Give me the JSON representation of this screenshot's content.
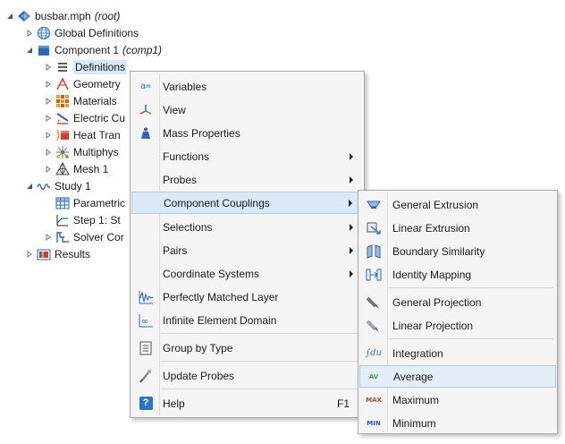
{
  "tree": {
    "root": {
      "label": "busbar.mph",
      "suffix": "(root)"
    },
    "global_definitions": "Global Definitions",
    "component": {
      "label": "Component 1",
      "suffix": "(comp1)"
    },
    "definitions": "Definitions",
    "geometry": "Geometry",
    "materials": "Materials",
    "electric_currents": "Electric Cu",
    "heat_transfer": "Heat Tran",
    "multiphysics": "Multiphys",
    "mesh": "Mesh 1",
    "study": "Study 1",
    "parametric": "Parametric",
    "step1": "Step 1: St",
    "solver": "Solver Cor",
    "results": "Results"
  },
  "context_menu": {
    "variables": "Variables",
    "view": "View",
    "mass_properties": "Mass Properties",
    "functions": "Functions",
    "probes": "Probes",
    "component_couplings": "Component Couplings",
    "selections": "Selections",
    "pairs": "Pairs",
    "coordinate_systems": "Coordinate Systems",
    "perfectly_matched_layer": "Perfectly Matched Layer",
    "infinite_element_domain": "Infinite Element Domain",
    "group_by_type": "Group by Type",
    "update_probes": "Update Probes",
    "help": "Help",
    "help_shortcut": "F1"
  },
  "submenu": {
    "general_extrusion": "General Extrusion",
    "linear_extrusion": "Linear Extrusion",
    "boundary_similarity": "Boundary Similarity",
    "identity_mapping": "Identity Mapping",
    "general_projection": "General Projection",
    "linear_projection": "Linear Projection",
    "integration": "Integration",
    "integration_icon_text": "∫du",
    "average": "Average",
    "average_icon_text": "AV",
    "maximum": "Maximum",
    "maximum_icon_text": "MAX",
    "minimum": "Minimum",
    "minimum_icon_text": "MIN"
  },
  "icons": {
    "variables_icon_text": "a=",
    "help_icon_text": "?"
  },
  "colors": {
    "highlight": "#dbe8f6",
    "highlight_border": "#aecbeb",
    "menu_bg": "#f5f5f5",
    "accent_blue": "#2a76c6",
    "max_red": "#d63b3b",
    "av_green": "#4a9e3c"
  }
}
